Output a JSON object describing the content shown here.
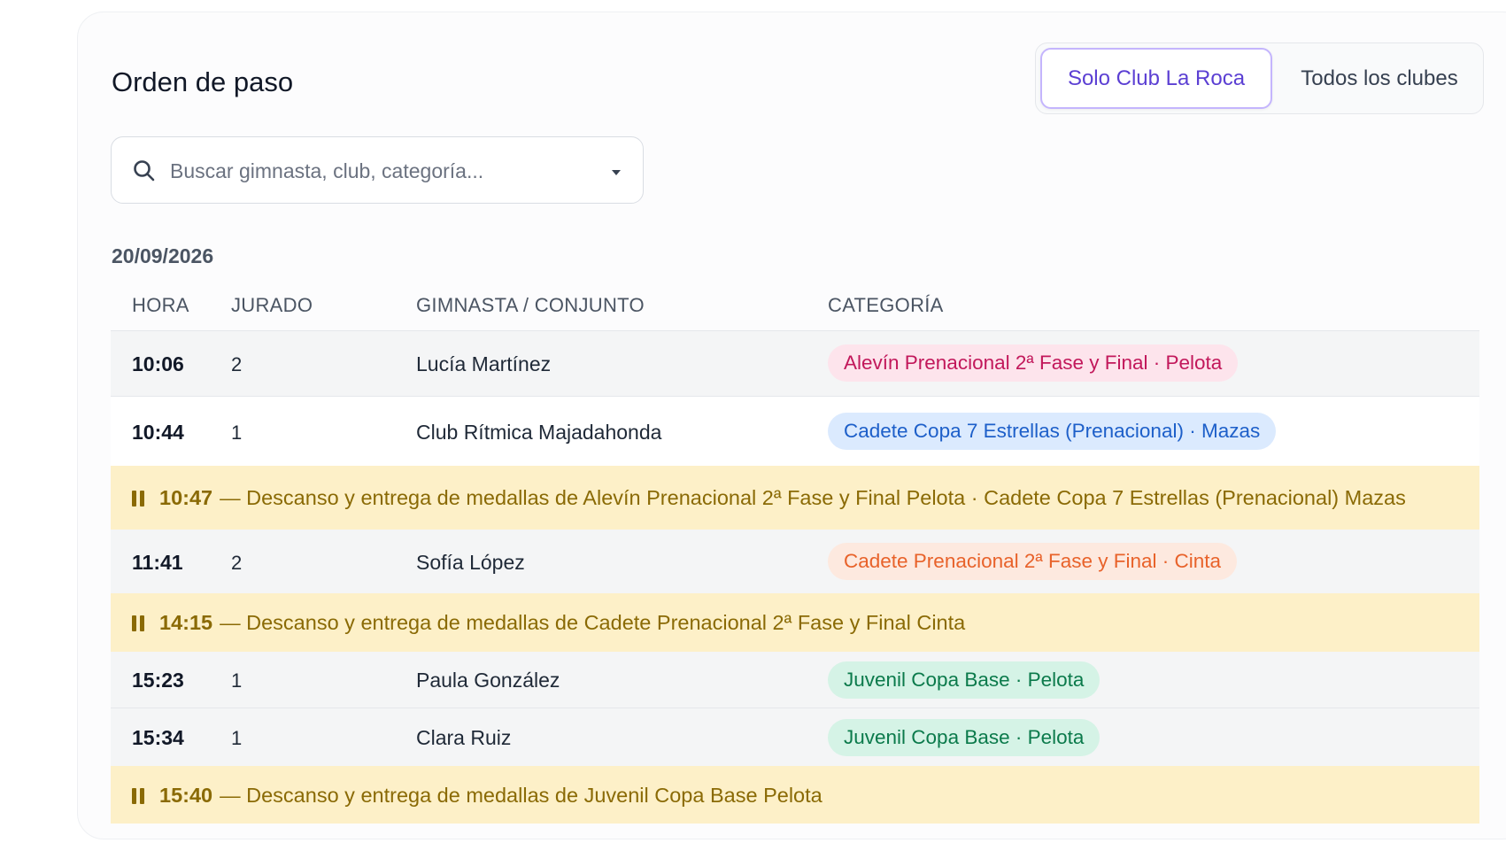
{
  "header": {
    "title": "Orden de paso"
  },
  "toggle": {
    "active_label": "Solo Club La Roca",
    "inactive_label": "Todos los clubes"
  },
  "search": {
    "placeholder": "Buscar gimnasta, club, categoría..."
  },
  "schedule": {
    "date": "20/09/2026",
    "columns": {
      "hora": "HORA",
      "jurado": "JURADO",
      "gimnasta": "GIMNASTA / CONJUNTO",
      "categoria": "CATEGORÍA"
    },
    "rows": [
      {
        "hora": "10:06",
        "jurado": "2",
        "nombre": "Lucía Martínez",
        "categoria": "Alevín Prenacional 2ª Fase y Final · Pelota",
        "badge_bg": "#fde4ec",
        "badge_fg": "#c2185b"
      },
      {
        "hora": "10:44",
        "jurado": "1",
        "nombre": "Club Rítmica Majadahonda",
        "categoria": "Cadete Copa 7 Estrellas (Prenacional) · Mazas",
        "badge_bg": "#dbeafe",
        "badge_fg": "#1d5fc9"
      },
      {
        "hora": "10:47",
        "text": "— Descanso y entrega de medallas de Alevín Prenacional 2ª Fase y Final Pelota · Cadete Copa 7 Estrellas (Prenacional) Mazas"
      },
      {
        "hora": "11:41",
        "jurado": "2",
        "nombre": "Sofía López",
        "categoria": "Cadete Prenacional 2ª Fase y Final · Cinta",
        "badge_bg": "#fde9df",
        "badge_fg": "#e8622a"
      },
      {
        "hora": "14:15",
        "text": "— Descanso y entrega de medallas de Cadete Prenacional 2ª Fase y Final Cinta"
      },
      {
        "hora": "15:23",
        "jurado": "1",
        "nombre": "Paula González",
        "categoria": "Juvenil Copa Base · Pelota",
        "badge_bg": "#d5f3e6",
        "badge_fg": "#0b7a4b"
      },
      {
        "hora": "15:34",
        "jurado": "1",
        "nombre": "Clara Ruiz",
        "categoria": "Juvenil Copa Base · Pelota",
        "badge_bg": "#d5f3e6",
        "badge_fg": "#0b7a4b"
      },
      {
        "hora": "15:40",
        "text": "— Descanso y entrega de medallas de Juvenil Copa Base Pelota"
      }
    ]
  },
  "colors": {
    "accent": "#5b3fd3",
    "break_bg": "#fdf0c8",
    "break_fg": "#8a6a05"
  },
  "icons": {
    "search": "search-icon",
    "caret": "chevron-down-icon",
    "pause": "pause-icon"
  }
}
